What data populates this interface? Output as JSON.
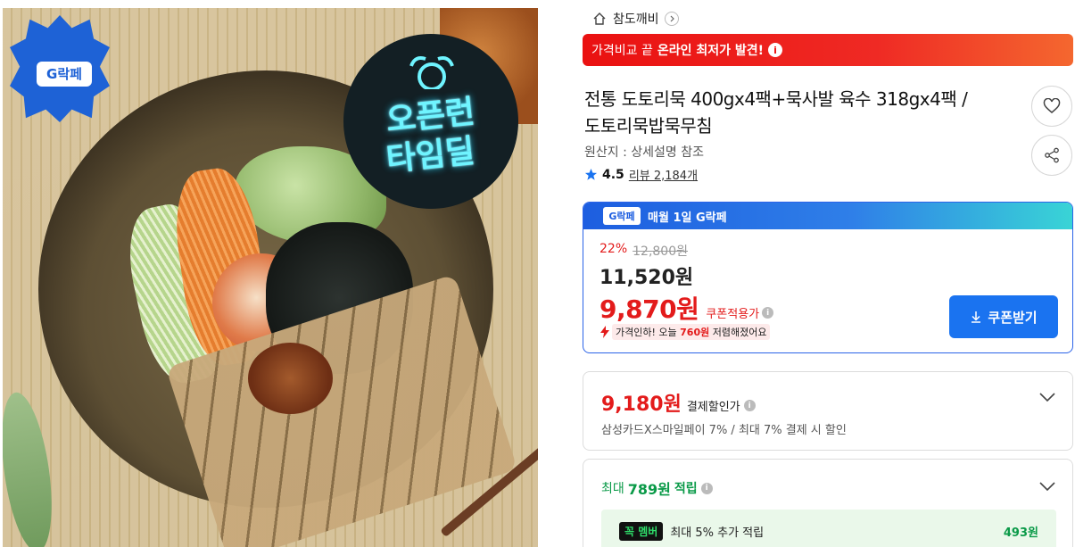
{
  "image": {
    "logo_text": "G락페",
    "badge_line1": "오픈런",
    "badge_line2": "타임딜"
  },
  "breadcrumb": {
    "home_icon": "home-icon",
    "seller": "참도깨비"
  },
  "promo_banner": {
    "prefix": "가격비교 끝",
    "highlight": "온라인 최저가 발견!",
    "info_icon": "info-icon",
    "colors": {
      "start": "#ea1111",
      "end": "#f4672f"
    }
  },
  "product": {
    "title_line1": "전통 도토리묵 400gx4팩+묵사발 육수 318gx4팩 /",
    "title_line2": "도토리묵밥묵무침",
    "origin": "원산지 : 상세설명 참조",
    "rating": "4.5",
    "review_text": "리뷰 2,184개"
  },
  "coupon_box": {
    "header_logo": "G락페",
    "header_text": "매월 1일 G락페",
    "discount_rate": "22%",
    "original_price": "12,800원",
    "sale_price": "11,520원",
    "coupon_price": "9,870원",
    "coupon_label": "쿠폰적용가",
    "price_drop_prefix": "가격인하! 오늘",
    "price_drop_amount": "760원",
    "price_drop_suffix": "저렴해졌어요",
    "coupon_button": "쿠폰받기",
    "accent_color": "#1a73f0",
    "price_color": "#e31b1b"
  },
  "card_discount": {
    "price": "9,180원",
    "label": "결제할인가",
    "description": "삼성카드X스마일페이 7% / 최대 7% 결제 시 할인"
  },
  "points": {
    "prefix": "최대",
    "amount": "789원",
    "suffix": "적립",
    "member_badge": "꼭 멤버",
    "member_text": "최대 5% 추가 적립",
    "member_amount": "493원"
  }
}
